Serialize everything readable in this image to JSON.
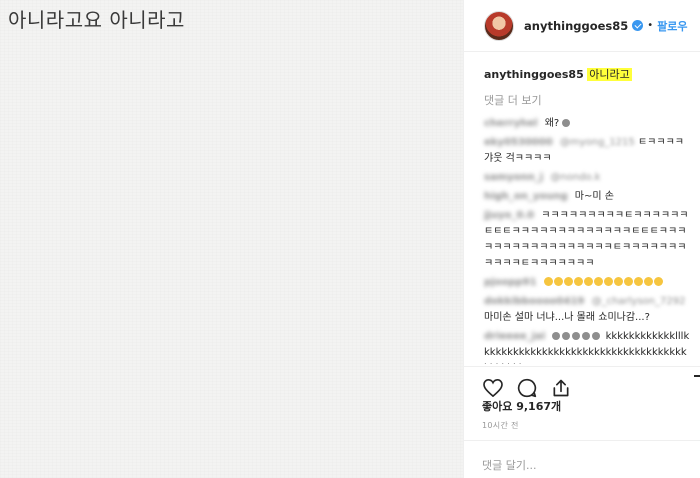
{
  "photo": {
    "caption": "아니라고요 아니라고"
  },
  "header": {
    "username": "anythinggoes85",
    "separator": "•",
    "follow_label": "팔로우"
  },
  "caption": {
    "username": "anythinggoes85",
    "text": "아니라고"
  },
  "more_comments_label": "댓글 더 보기",
  "comments": [
    {
      "user": "cherryhel",
      "mention": "",
      "text": "왜?"
    },
    {
      "user": "eky0530000",
      "mention": "@myong_1215",
      "text": "ㅌㅋㅋㅋㅋ갸웃 걱ㅋㅋㅋㅋ"
    },
    {
      "user": "samyonn_j",
      "mention": "@nondo.k",
      "text": ""
    },
    {
      "user": "high_on_young",
      "mention": "",
      "text": "마~미 손"
    },
    {
      "user": "jjuyo_0.0",
      "mention": "",
      "text": "ㅋㅋㅋㅋㅋㅋㅋㅋㅋㅌㅋㅋㅋㅋㅋㅋㅌㅌㅌㅋㅋㅋㅋㅋㅋㅋㅋㅋㅋㅋㅋㅋㅌㅌㅌㅋㅋㅋㅋㅋㅋㅋㅋㅋㅋㅋㅋㅋㅋㅋㅋㅋㅌㅋㅋㅋㅋㅋㅋㅋㅋㅋㅋㅋㅌㅋㅋㅋㅋㅋㅋㅋ"
    },
    {
      "user": "pjoopp91",
      "mention": "",
      "text": ""
    },
    {
      "user": "dokkibboooo0419",
      "mention": "@_charlyson_7292",
      "text": "마미손 설마 너냐...나 몰래 쇼미나감...?"
    },
    {
      "user": "drieeee_jai",
      "mention": "",
      "text": "kkkkkkkkkkkklllkkkkkkkkkkkkkkkkkkkkkkkkkkkkkkkkkkkkkkkkkkk"
    }
  ],
  "likes": {
    "label": "좋아요",
    "count": "9,167개"
  },
  "timestamp": "10시간 전",
  "comment_input": {
    "placeholder": "댓글 달기..."
  },
  "icons": {
    "like": "heart-icon",
    "comment": "comment-icon",
    "share": "share-icon",
    "save": "bookmark-icon",
    "verified": "verified-badge-icon"
  },
  "colors": {
    "link": "#3897f0",
    "highlight": "#ffff3b",
    "muted": "#999999"
  }
}
